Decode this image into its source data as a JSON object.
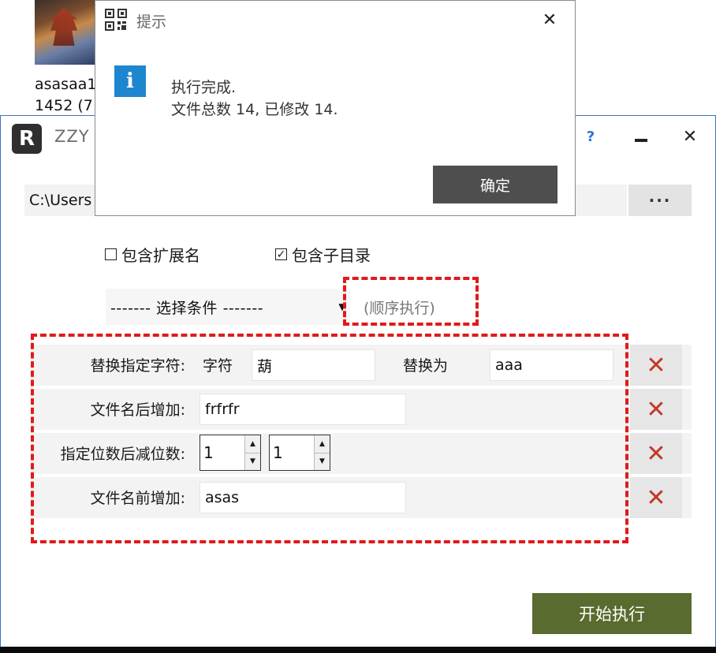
{
  "desktop": {
    "file_name": "asasaa1",
    "file_size": "1452 (7"
  },
  "window": {
    "logo_letter": "R",
    "title": "ZZY",
    "help_glyph": "?",
    "close_glyph": "✕",
    "path_value": "C:\\Users",
    "browse_label": "···",
    "options": {
      "include_ext_label": "包含扩展名",
      "include_ext_checked": false,
      "include_subdir_label": "包含子目录",
      "include_subdir_checked": true
    },
    "condition_select": "------- 选择条件 -------",
    "sequence_label": "(顺序执行)",
    "rules": {
      "replace": {
        "label": "替换指定字符:",
        "char_label": "字符",
        "char_value": "葫",
        "replace_with_label": "替换为",
        "replace_with_value": "aaa"
      },
      "append_after": {
        "label": "文件名后增加:",
        "value": "frfrfr"
      },
      "trim_after": {
        "label": "指定位数后减位数:",
        "value1": "1",
        "value2": "1"
      },
      "prepend": {
        "label": "文件名前增加:",
        "value": "asas"
      },
      "delete_glyph": "✕"
    },
    "start_button": "开始执行"
  },
  "dialog": {
    "title": "提示",
    "close_glyph": "✕",
    "info_glyph": "i",
    "message_line1": "执行完成.",
    "message_line2": "文件总数 14, 已修改 14.",
    "ok_button": "确定"
  },
  "colors": {
    "start_button": "#5a6b2f",
    "ok_button": "#4e4e4e",
    "info_icon": "#1e86cf",
    "annotation_dash": "#e01a1a",
    "delete_icon": "#c0392b",
    "help_icon": "#2f73d8"
  }
}
